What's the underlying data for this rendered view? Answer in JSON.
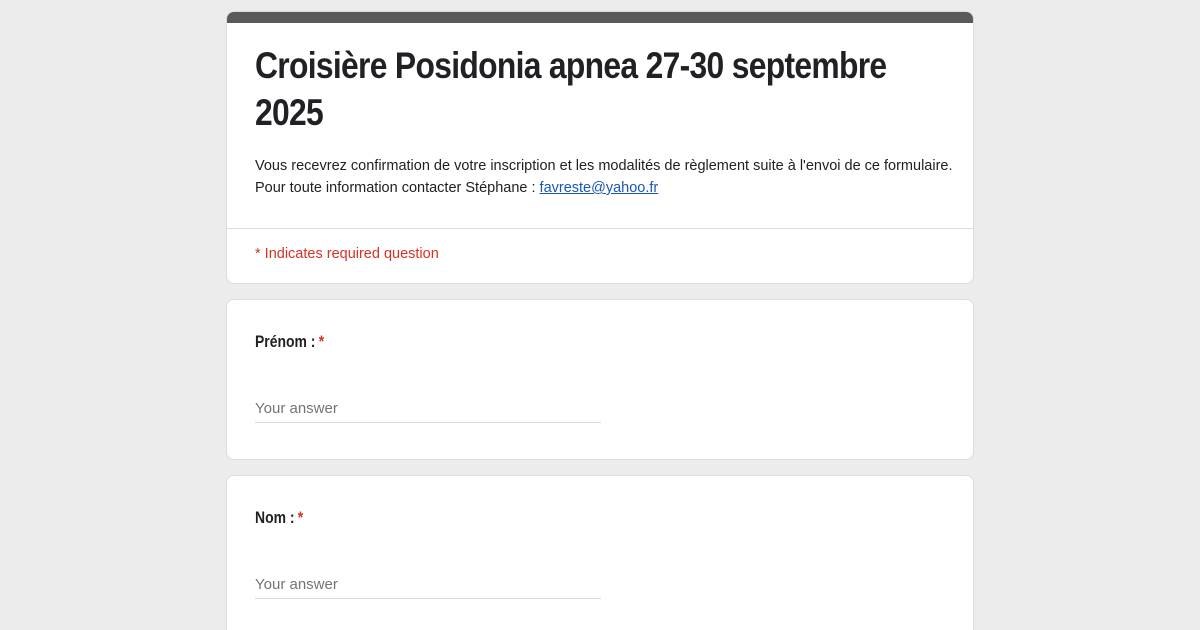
{
  "form": {
    "title": "Croisière Posidonia apnea  27-30 septembre 2025",
    "description_text": "Vous recevrez confirmation de votre inscription et les modalités de règlement suite à l'envoi de ce formulaire. Pour toute information contacter Stéphane : ",
    "contact_email": "favreste@yahoo.fr",
    "required_note": "* Indicates required question",
    "colors": {
      "header_bar": "#5a5a5a",
      "required": "#d93025",
      "link": "#1a56b8",
      "background": "#ececec"
    }
  },
  "questions": [
    {
      "label": "Prénom :",
      "required_marker": "*",
      "placeholder": "Your answer",
      "value": ""
    },
    {
      "label": "Nom :",
      "required_marker": "*",
      "placeholder": "Your answer",
      "value": ""
    }
  ]
}
